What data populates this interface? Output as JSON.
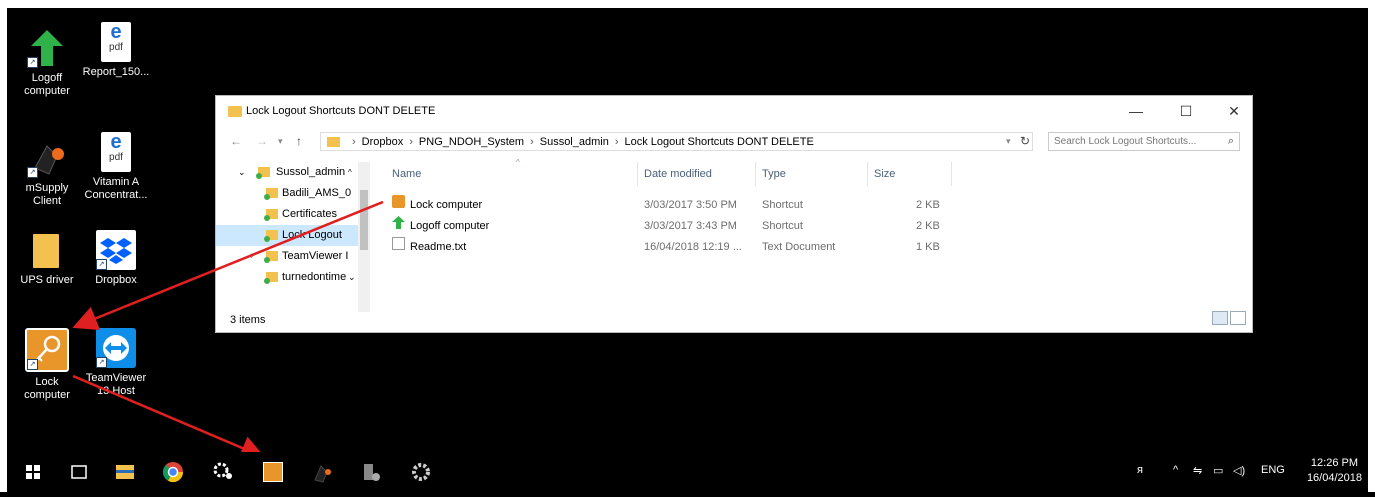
{
  "desktop": {
    "icons": [
      {
        "label_line1": "Logoff",
        "label_line2": "computer",
        "icon": "green-arrow-icon"
      },
      {
        "label_line1": "Report_150...",
        "label_line2": "",
        "icon": "pdf-file-icon"
      },
      {
        "label_line1": "mSupply",
        "label_line2": "Client",
        "icon": "msupply-icon"
      },
      {
        "label_line1": "Vitamin A",
        "label_line2": "Concentrat...",
        "icon": "pdf-file-icon"
      },
      {
        "label_line1": "UPS driver",
        "label_line2": "",
        "icon": "folder-icon"
      },
      {
        "label_line1": "Dropbox",
        "label_line2": "",
        "icon": "dropbox-icon"
      },
      {
        "label_line1": "Lock",
        "label_line2": "computer",
        "icon": "key-icon"
      },
      {
        "label_line1": "TeamViewer",
        "label_line2": "13 Host",
        "icon": "teamviewer-icon"
      }
    ],
    "pdf_text_top": "e",
    "pdf_text_bottom": "pdf"
  },
  "explorer": {
    "title": "Lock Logout Shortcuts DONT DELETE",
    "controls": {
      "minimize": "—",
      "maximize": "☐",
      "close": "✕"
    },
    "breadcrumb": [
      "Dropbox",
      "PNG_NDOH_System",
      "Sussol_admin",
      "Lock Logout Shortcuts DONT DELETE"
    ],
    "search_placeholder": "Search Lock Logout Shortcuts...",
    "nav": [
      {
        "label": "Sussol_admin",
        "expanded": true
      },
      {
        "label": "Badili_AMS_0"
      },
      {
        "label": "Certificates"
      },
      {
        "label": "Lock Logout",
        "selected": true
      },
      {
        "label": "TeamViewer I",
        "collapsed": true
      },
      {
        "label": "turnedontime"
      }
    ],
    "columns": {
      "name": "Name",
      "date": "Date modified",
      "type": "Type",
      "size": "Size"
    },
    "files": [
      {
        "name": "Lock computer",
        "date": "3/03/2017 3:50 PM",
        "type": "Shortcut",
        "size": "2 KB",
        "icon": "key-icon"
      },
      {
        "name": "Logoff computer",
        "date": "3/03/2017 3:43 PM",
        "type": "Shortcut",
        "size": "2 KB",
        "icon": "green-arrow-icon"
      },
      {
        "name": "Readme.txt",
        "date": "16/04/2018 12:19 ...",
        "type": "Text Document",
        "size": "1 KB",
        "icon": "text-file-icon"
      }
    ],
    "status": "3 items"
  },
  "taskbar": {
    "tray_lang": "ENG",
    "time": "12:26 PM",
    "date": "16/04/2018"
  },
  "colors": {
    "desktop": "#000000",
    "folder": "#f2c14e",
    "key_tile": "#e8952a",
    "annotation": "#e02020",
    "selection": "#cce8ff"
  }
}
